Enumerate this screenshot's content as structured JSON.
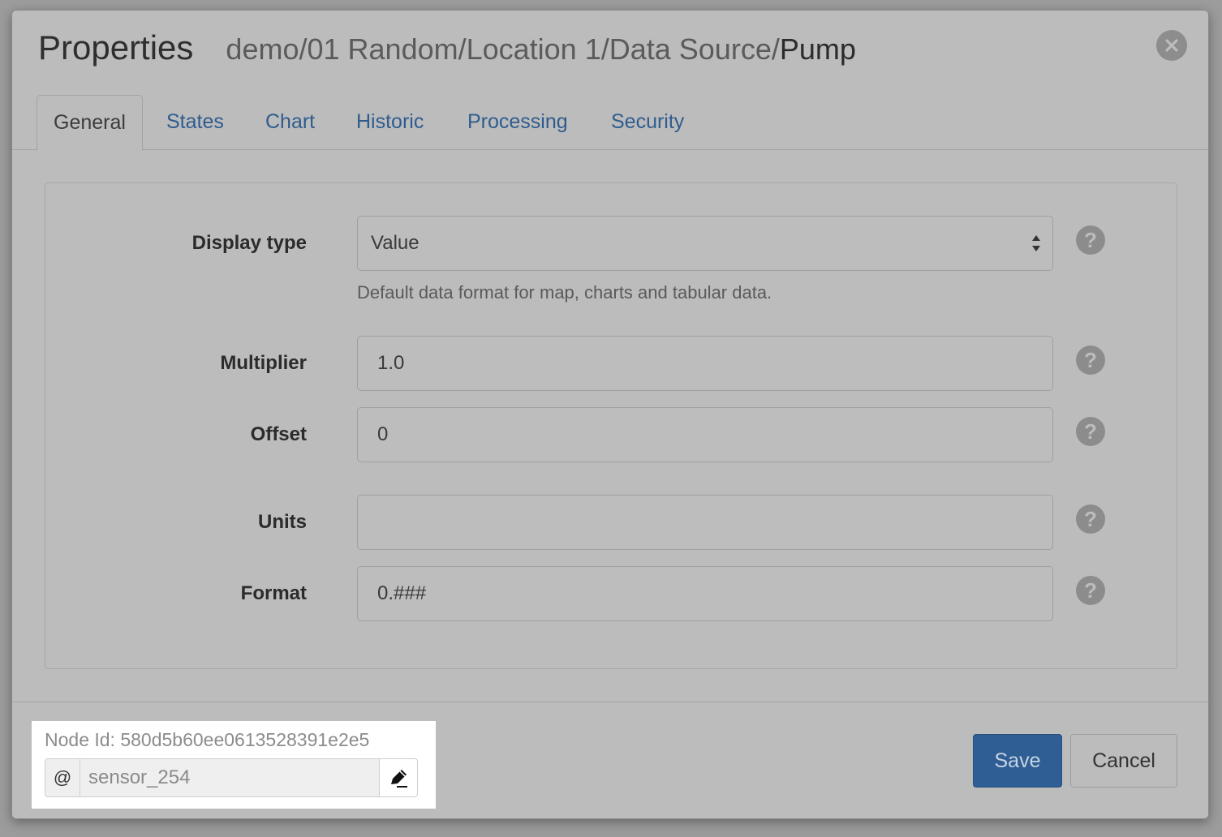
{
  "header": {
    "title": "Properties",
    "path_prefix": "demo/01 Random/Location 1/Data Source/",
    "path_leaf": "Pump",
    "close_icon": "close-icon"
  },
  "tabs": [
    {
      "label": "General",
      "active": true
    },
    {
      "label": "States",
      "active": false
    },
    {
      "label": "Chart",
      "active": false
    },
    {
      "label": "Historic",
      "active": false
    },
    {
      "label": "Processing",
      "active": false
    },
    {
      "label": "Security",
      "active": false
    }
  ],
  "form": {
    "display_type": {
      "label": "Display type",
      "value": "Value",
      "help": "Default data format for map, charts and tabular data."
    },
    "multiplier": {
      "label": "Multiplier",
      "value": "1.0"
    },
    "offset": {
      "label": "Offset",
      "value": "0"
    },
    "units": {
      "label": "Units",
      "value": ""
    },
    "format": {
      "label": "Format",
      "value": "0.###"
    },
    "help_glyph": "?"
  },
  "footer": {
    "node_id": "Node Id: 580d5b60ee0613528391e2e5",
    "alias_prefix": "@",
    "alias_value": "sensor_254",
    "save_label": "Save",
    "cancel_label": "Cancel"
  },
  "colors": {
    "primary": "#2f5e95",
    "link": "#2f5c8e"
  }
}
